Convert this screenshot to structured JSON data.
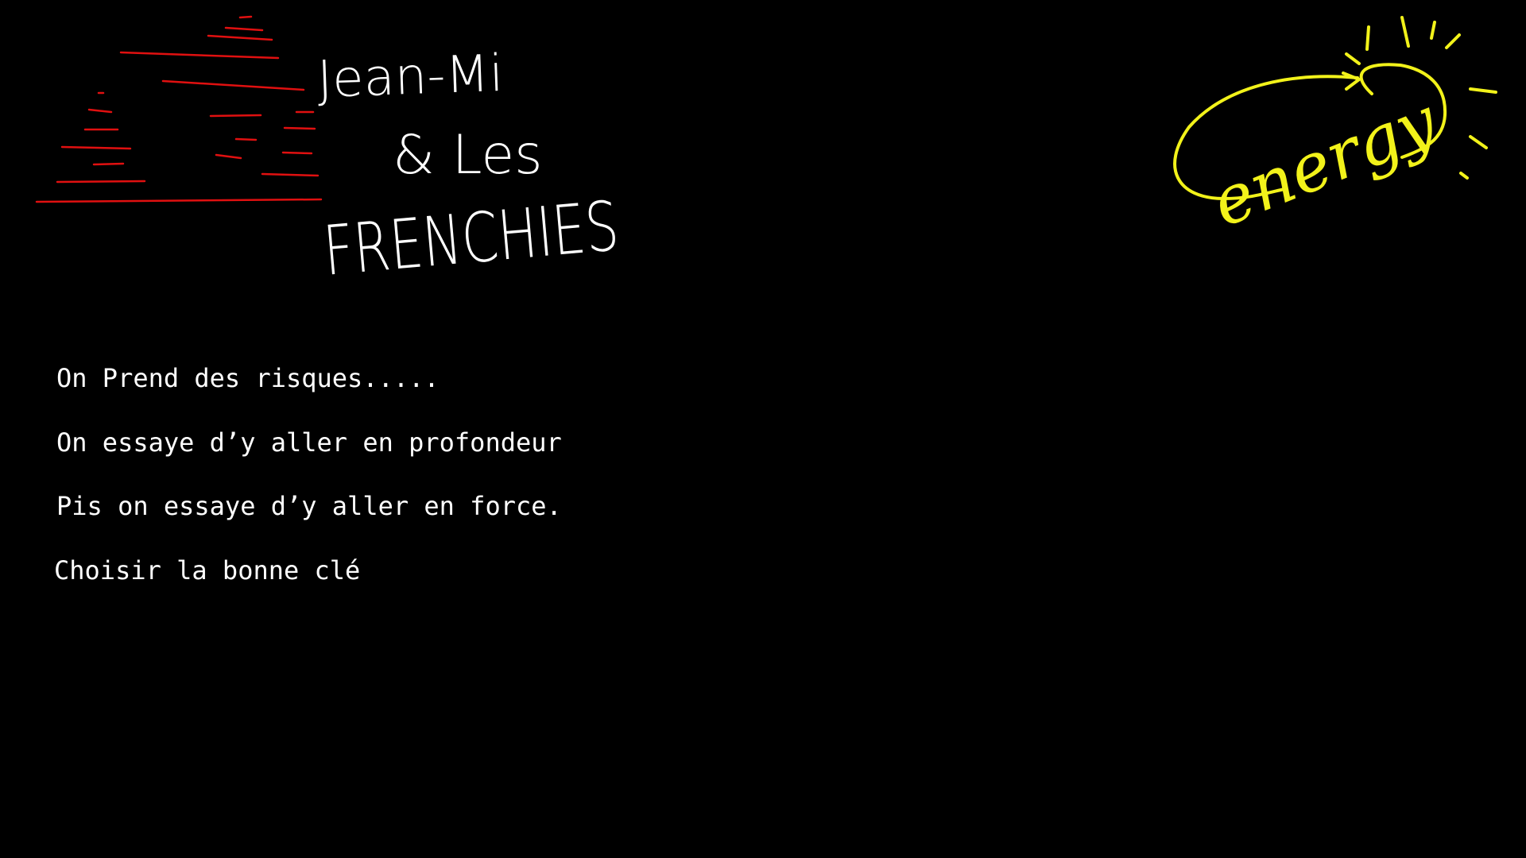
{
  "logo": {
    "title_line1": "Jean-Mi",
    "title_line2": "& Les",
    "title_line3": "FRENCHIES",
    "stripe_color": "#e01010"
  },
  "energy_badge": {
    "word": "energy",
    "color": "#f2f21a",
    "icon": "lightbulb-icon"
  },
  "text_lines": [
    "On Prend des risques.....",
    "On essaye d’y aller en profondeur",
    "Pis on essaye d’y aller en force.",
    "Choisir la bonne clé"
  ],
  "colors": {
    "background": "#000000",
    "text": "#ffffff"
  }
}
